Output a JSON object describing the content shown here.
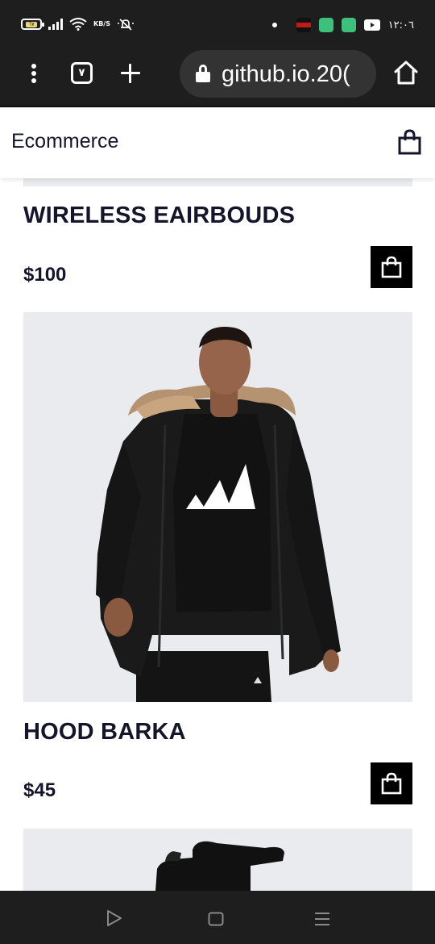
{
  "status_bar": {
    "battery_label": "٦٧",
    "data_rate": "KB/S",
    "time": "١٢:٠٦",
    "app_badge_colors": [
      "#c11b17",
      "#3ec07d",
      "#3ec07d"
    ]
  },
  "browser": {
    "tab_count": "٧",
    "url": "github.io.github.io20‎",
    "url_display": ")20.github.io"
  },
  "header": {
    "brand": "Ecommerce"
  },
  "products": [
    {
      "title": "WIRELESS EAIRBOUDS",
      "price": "$100"
    },
    {
      "title": "HOOD BARKA",
      "price": "$45"
    }
  ]
}
